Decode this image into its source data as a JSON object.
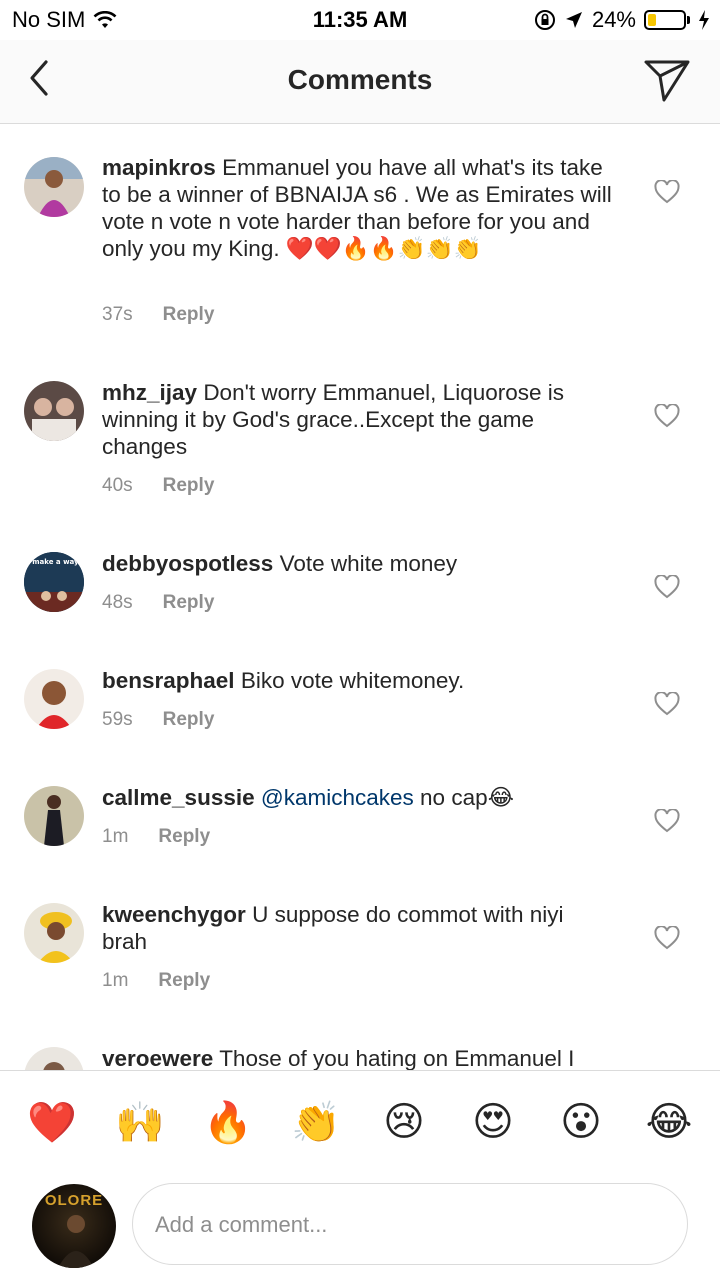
{
  "status_bar": {
    "carrier": "No SIM",
    "time": "11:35 AM",
    "battery_percent": "24%",
    "battery_level": 0.24,
    "battery_color": "#f7c600"
  },
  "nav": {
    "title": "Comments",
    "back_icon": "chevron-left-icon",
    "send_icon": "paper-plane-icon"
  },
  "comments": [
    {
      "username": "mapinkros",
      "text": "Emmanuel you have all what's its take to be a winner of BBNAIJA s6 . We as Emirates will vote n vote n vote harder than before for you and only you my King. ❤️❤️🔥🔥👏👏👏",
      "time": "37s",
      "reply": "Reply"
    },
    {
      "username": "mhz_ijay",
      "text": "Don't worry Emmanuel, Liquorose is winning it by God's grace..Except the game changes",
      "time": "40s",
      "reply": "Reply"
    },
    {
      "username": "debbyospotless",
      "text": "Vote white money",
      "time": "48s",
      "reply": "Reply",
      "avatar_text": "GOD will make a way for you."
    },
    {
      "username": "bensraphael",
      "text": "Biko vote whitemoney.",
      "time": "59s",
      "reply": "Reply"
    },
    {
      "username": "callme_sussie",
      "mention": "@kamichcakes",
      "text": "no cap😂",
      "time": "1m",
      "reply": "Reply"
    },
    {
      "username": "kweenchygor",
      "text": "U suppose do commot with niyi brah",
      "time": "1m",
      "reply": "Reply"
    },
    {
      "username": "veroewere",
      "text": "Those of you hating on Emmanuel I"
    }
  ],
  "reactions": [
    "❤️",
    "🙌",
    "🔥",
    "👏",
    "😢",
    "😍",
    "😮",
    "😂"
  ],
  "composer": {
    "placeholder": "Add a comment...",
    "avatar_text": "OLORE"
  }
}
